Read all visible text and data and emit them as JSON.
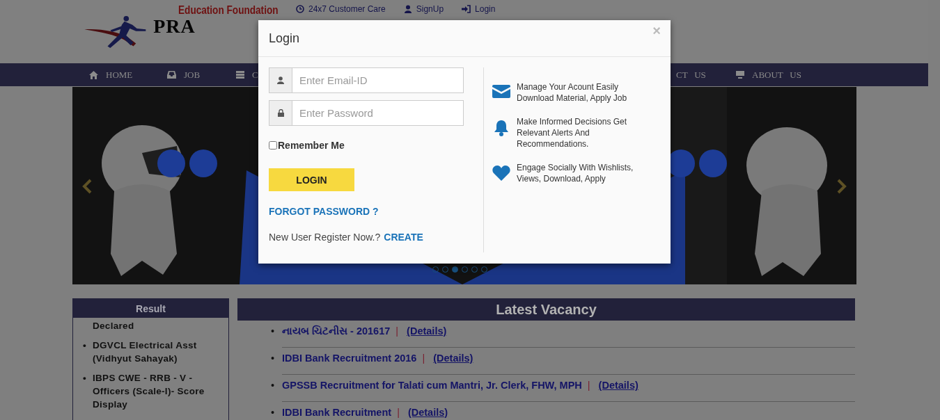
{
  "header": {
    "logo_top": "Education Foundation",
    "logo_main": "PRA",
    "top_links": [
      {
        "label": "24x7 Customer Care"
      },
      {
        "label": "SignUp"
      },
      {
        "label": "Login"
      }
    ]
  },
  "nav": [
    {
      "label": "HOME"
    },
    {
      "label": "JOB"
    },
    {
      "label": "C"
    },
    {
      "label": "CT   US"
    },
    {
      "label": "ABOUT   US"
    }
  ],
  "slider": {
    "dots": [
      {
        "selected": false
      },
      {
        "selected": false
      },
      {
        "selected": true
      },
      {
        "selected": false
      },
      {
        "selected": false
      },
      {
        "selected": false
      }
    ]
  },
  "result": {
    "title": "Result",
    "items": [
      {
        "text": "Declared"
      },
      {
        "bullet": "•",
        "text": "DGVCL Electrical Asst (Vidhyut Sahayak)"
      },
      {
        "bullet": "•",
        "text": "IBPS CWE - RRB - V - Officers (Scale-I)- Score Display"
      }
    ]
  },
  "vacancy": {
    "title": "Latest Vacancy",
    "rows": [
      {
        "bullet": "•",
        "text": "નાયબ ચિટનીસ - 201617",
        "separator": "|",
        "link": "(Details)"
      },
      {
        "bullet": "•",
        "text": "IDBI Bank Recruitment 2016",
        "separator": "|",
        "link": "(Details)"
      },
      {
        "bullet": "•",
        "text": "GPSSB Recruitment for Talati cum Mantri, Jr. Clerk, FHW, MPH",
        "separator": "|",
        "link": "(Details)"
      },
      {
        "bullet": "•",
        "text": "IDBI Bank Recruitment",
        "separator": "|",
        "link": "(Details)"
      }
    ]
  },
  "modal": {
    "title": "Login",
    "close": "×",
    "email": {
      "placeholder": "Enter Email-ID"
    },
    "password": {
      "placeholder": "Enter Password"
    },
    "remember": {
      "label": "Remember Me",
      "checked": false
    },
    "login_button": "LOGIN",
    "forgot": "FORGOT PASSWORD ?",
    "register_text": "New User Register Now.?",
    "register_link": "CREATE",
    "features": [
      {
        "text": "Manage Your Acount Easily Download Material, Apply Job"
      },
      {
        "text": "Make Informed Decisions Get Relevant Alerts And Recommendations."
      },
      {
        "text": "Engage Socially With Wishlists, Views, Download, Apply"
      }
    ]
  }
}
